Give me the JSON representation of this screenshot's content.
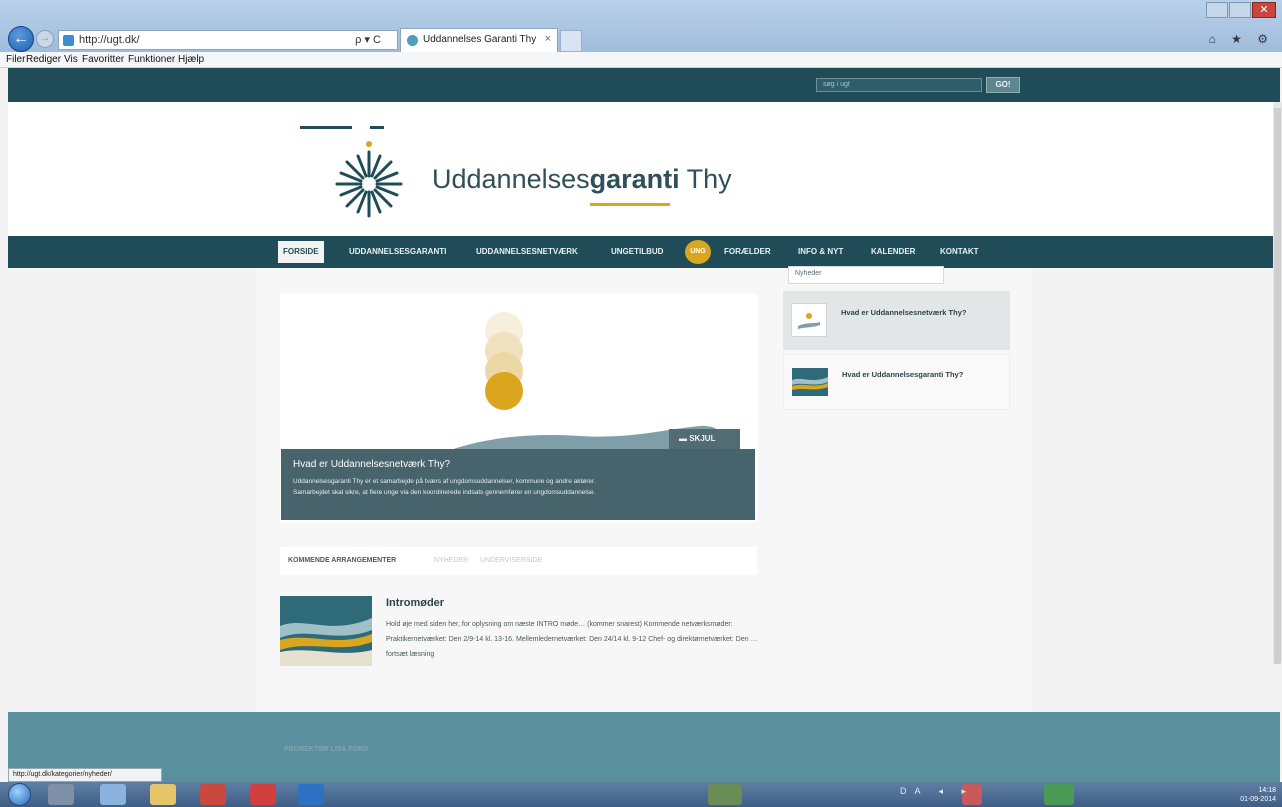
{
  "browser": {
    "address": "http://ugt.dk/",
    "address_tools": "ρ ▾ C",
    "tab_title": "Uddannelses Garanti Thy",
    "tab_close": "×",
    "back_glyph": "←",
    "forward_glyph": "→",
    "window_close_glyph": "✕",
    "right_icons": "⌂ ★ ⚙",
    "menu": [
      "Filer",
      "Rediger",
      "Vis",
      "Favoritter",
      "Funktioner",
      "Hjælp"
    ],
    "status_url": "http://ugt.dk/kategorier/nyheder/"
  },
  "site": {
    "search_placeholder": "søg i ugt",
    "search_button": "GO!",
    "name_prefix": "Uddannelses",
    "name_bold": "garanti",
    "name_suffix": " Thy",
    "nav": [
      "FORSIDE",
      "UDDANNELSESGARANTI",
      "UDDANNELSESNETVÆRK",
      "UNGETILBUD",
      "UNG",
      "FORÆLDER",
      "INFO & NYT",
      "KALENDER",
      "KONTAKT"
    ],
    "submenu": [
      "Nyheder"
    ],
    "slider": {
      "close_label": "▬  SKJUL",
      "title": "Hvad er Uddannelsesnetværk Thy?",
      "body_1": "Uddannelsesgaranti Thy er et samarbejde på tværs af ungdomsuddannelser, kommune og andre aktører.",
      "body_2": "Samarbejdet skal sikre, at flere unge via den koordinerede indsats gennemfører en ungdomsuddannelse."
    },
    "tabs": [
      "KOMMENDE ARRANGEMENTER",
      "NYHEDER",
      "UNDERVISERSIDE"
    ],
    "event": {
      "title": "Intromøder",
      "text": "Hold øje med siden her, for oplysning om næste INTRO møde… (kommer snarest) Kommende netværksmøder: Praktikernetværket: Den 2/9-14 kl. 13-16. Mellemledernetværket: Den 24/14 kl. 9-12 Chef- og direktørnetværket: Den …",
      "more": "fortsæt læsning"
    },
    "sidebar": [
      {
        "title": "Hvad er Uddannelsesnetværk Thy?"
      },
      {
        "title": "Hvad er Uddannelsesgaranti Thy?"
      }
    ],
    "footer_text": "PROREKTØR LISA FORD"
  },
  "taskbar": {
    "clock_time": "14:18",
    "clock_date": "01-09-2014",
    "tray": "DA ◂ ▸"
  },
  "colors": {
    "brand_dark": "#1f4c57",
    "accent_gold": "#d9a61d",
    "caption_bg": "#47636b",
    "footer_bg": "#5a8f9d"
  }
}
